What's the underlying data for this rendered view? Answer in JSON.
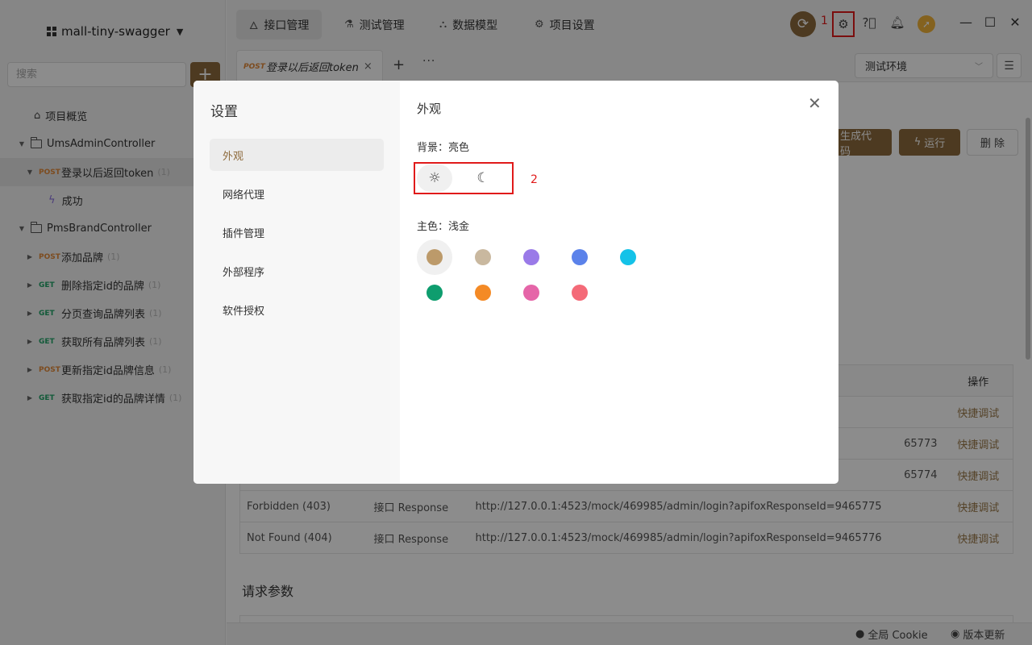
{
  "sidebar": {
    "project_name": "mall-tiny-swagger",
    "search_placeholder": "搜索",
    "add_label": "+",
    "overview_label": "项目概览",
    "groups": [
      {
        "name": "UmsAdminController"
      },
      {
        "name": "PmsBrandController"
      }
    ],
    "items": [
      {
        "method": "POST",
        "label": "登录以后返回token",
        "count": "(1)"
      },
      {
        "label": "成功"
      },
      {
        "method": "POST",
        "label": "添加品牌",
        "count": "(1)"
      },
      {
        "method": "GET",
        "label": "删除指定id的品牌",
        "count": "(1)"
      },
      {
        "method": "GET",
        "label": "分页查询品牌列表",
        "count": "(1)"
      },
      {
        "method": "GET",
        "label": "获取所有品牌列表",
        "count": "(1)"
      },
      {
        "method": "POST",
        "label": "更新指定id品牌信息",
        "count": "(1)"
      },
      {
        "method": "GET",
        "label": "获取指定id的品牌详情",
        "count": "(1)"
      }
    ]
  },
  "topnav": {
    "tabs": [
      {
        "label": "接口管理"
      },
      {
        "label": "测试管理"
      },
      {
        "label": "数据模型"
      },
      {
        "label": "项目设置"
      }
    ],
    "annotation_1": "1"
  },
  "reqtabs": {
    "tab_method": "POST",
    "tab_label": "登录以后返回token",
    "env_label": "测试环境"
  },
  "actions": {
    "generate": "生成代码",
    "run": "运行",
    "delete": "删 除"
  },
  "table": {
    "op_header": "操作",
    "rows": [
      {
        "name": "",
        "type": "",
        "url": "",
        "op": "快捷调试"
      },
      {
        "name": "",
        "type": "",
        "url": "65773",
        "op": "快捷调试"
      },
      {
        "name": "",
        "type": "",
        "url": "65774",
        "op": "快捷调试"
      },
      {
        "name": "Forbidden (403)",
        "type": "接口 Response",
        "url": "http://127.0.0.1:4523/mock/469985/admin/login?apifoxResponseId=9465775",
        "op": "快捷调试"
      },
      {
        "name": "Not Found (404)",
        "type": "接口 Response",
        "url": "http://127.0.0.1:4523/mock/469985/admin/login?apifoxResponseId=9465776",
        "op": "快捷调试"
      }
    ]
  },
  "section": {
    "request_params": "请求参数"
  },
  "statusbar": {
    "cookie": "全局 Cookie",
    "update": "版本更新"
  },
  "modal": {
    "title": "设置",
    "menu": [
      {
        "label": "外观"
      },
      {
        "label": "网络代理"
      },
      {
        "label": "插件管理"
      },
      {
        "label": "外部程序"
      },
      {
        "label": "软件授权"
      }
    ],
    "section_title": "外观",
    "background_label": "背景：亮色",
    "color_label": "主色：浅金",
    "annotation_2": "2",
    "swatches": [
      "#bc9a6a",
      "#c9b89f",
      "#9a7ae8",
      "#5b82ea",
      "#14c2e8",
      "#0e9d6e",
      "#f48a25",
      "#e565a8",
      "#f46a78"
    ]
  }
}
